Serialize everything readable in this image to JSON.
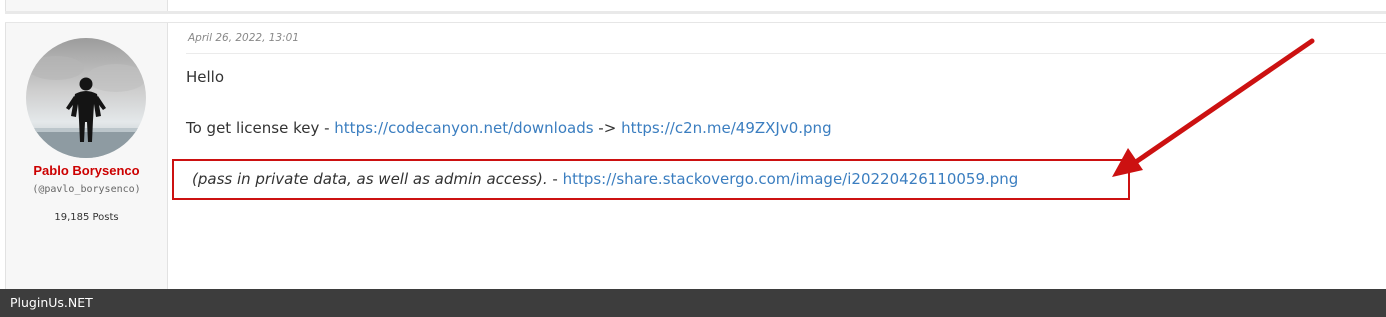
{
  "post": {
    "date": "April 26, 2022, 13:01",
    "author": {
      "name": "Pablo Borysenco",
      "handle": "(@pavlo_borysenco)",
      "posts": "19,185 Posts"
    },
    "body": {
      "greeting": "Hello",
      "license_prefix": "To get  license  key - ",
      "license_link1": "https://codecanyon.net/downloads",
      "license_arrow": " -> ",
      "license_link2": "https://c2n.me/49ZXJv0.png",
      "note_text": "(pass in private data, as well as admin access).",
      "note_dash": " - ",
      "note_link": "https://share.stackovergo.com/image/i20220426110059.png"
    }
  },
  "footer": {
    "site_name": "PluginUs.NET"
  },
  "colors": {
    "author_name": "#cc0000",
    "link": "#3b7ec0",
    "annotation": "#cc1111",
    "footer_bg": "#3d3d3d"
  }
}
